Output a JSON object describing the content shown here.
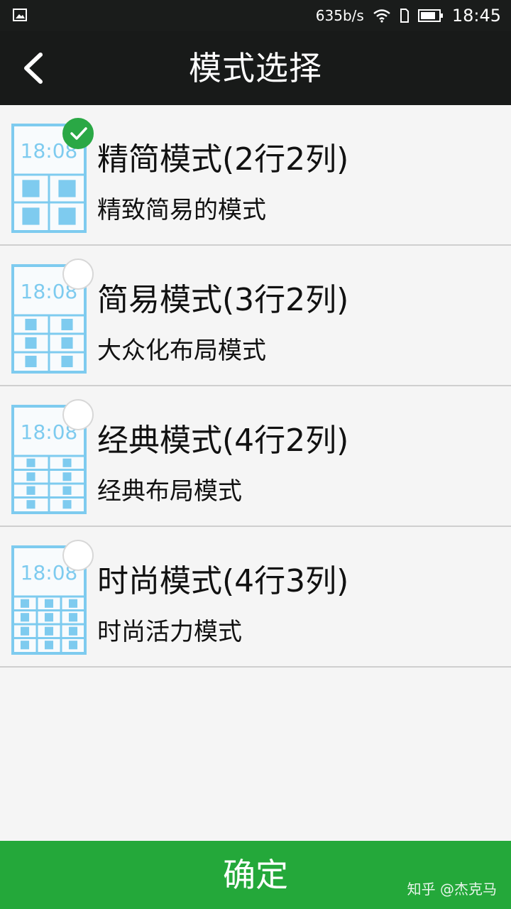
{
  "status_bar": {
    "speed": "635b/s",
    "time": "18:45"
  },
  "header": {
    "title": "模式选择"
  },
  "modes": [
    {
      "name": "精简模式(2行2列)",
      "description": "精致简易的模式",
      "selected": true,
      "rows": 2,
      "cols": 2
    },
    {
      "name": "简易模式(3行2列)",
      "description": "大众化布局模式",
      "selected": false,
      "rows": 3,
      "cols": 2
    },
    {
      "name": "经典模式(4行2列)",
      "description": "经典布局模式",
      "selected": false,
      "rows": 4,
      "cols": 2
    },
    {
      "name": "时尚模式(4行3列)",
      "description": "时尚活力模式",
      "selected": false,
      "rows": 4,
      "cols": 3
    }
  ],
  "thumbnail_time": "18:08",
  "confirm_button": {
    "label": "确定"
  },
  "watermark": "知乎 @杰克马",
  "colors": {
    "accent": "#24a83a",
    "thumb": "#7ecbef",
    "header": "#181a19"
  }
}
